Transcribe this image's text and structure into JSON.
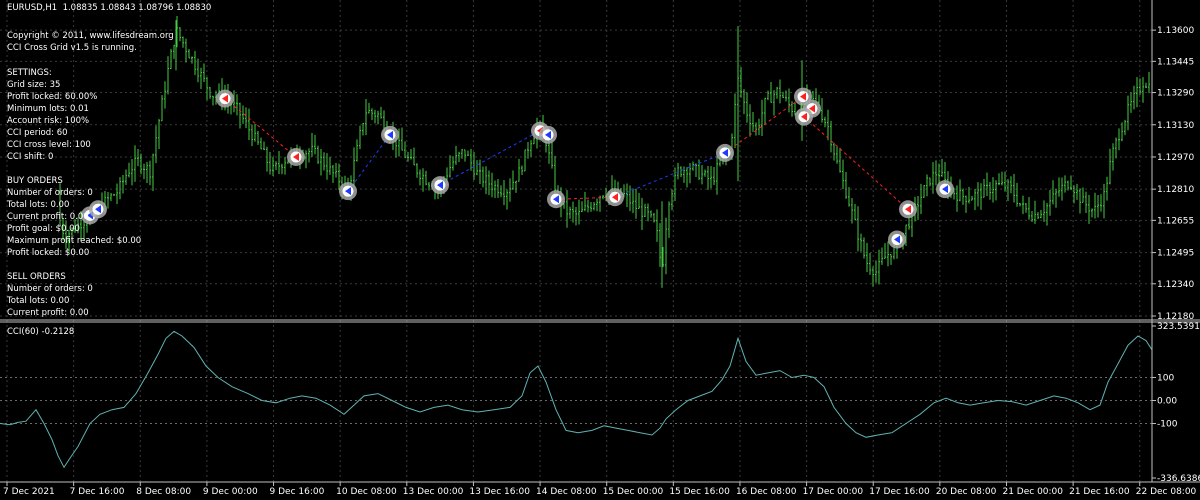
{
  "header": {
    "symbol_line": "EURUSD,H1  1.08835 1.08843 1.08796 1.08830",
    "copyright": "Copyright © 2011, www.lifesdream.org",
    "running": "CCI Cross Grid v1.5 is running."
  },
  "settings": {
    "title": "SETTINGS:",
    "lines": [
      "Grid size: 35",
      "Profit locked: 60.00%",
      "Minimum lots: 0.01",
      "Account risk: 100%",
      "CCI period: 60",
      "CCI cross level: 100",
      "CCI shift: 0"
    ]
  },
  "buy_orders": {
    "title": "BUY ORDERS",
    "lines": [
      "Number of orders: 0",
      "Total lots: 0.00",
      "Current profit: 0.00",
      "Profit goal: $0.00",
      "Maximum profit reached: $0.00",
      "Profit locked: $0.00"
    ]
  },
  "sell_orders": {
    "title": "SELL ORDERS",
    "lines": [
      "Number of orders: 0",
      "Total lots: 0.00",
      "Current profit: 0.00"
    ]
  },
  "cci_panel": {
    "label": "CCI(60) -0.2128"
  },
  "colors": {
    "background": "#000000",
    "grid": "#3a3a3a",
    "candles": "#44cc44",
    "cci_line": "#5fb3b3",
    "buy_marker": "#1e3cff",
    "sell_marker": "#ff2020",
    "marker_ring": "#a8a8a8"
  },
  "chart_data": [
    {
      "type": "bar",
      "subtype": "ohlc-candlestick",
      "instrument": "EURUSD",
      "timeframe": "H1",
      "ylim": [
        1.1218,
        1.137
      ],
      "y_ticks": [
        "1.13600",
        "1.13445",
        "1.13290",
        "1.13130",
        "1.12970",
        "1.12810",
        "1.12655",
        "1.12495",
        "1.12340",
        "1.12180"
      ],
      "y_tick_values": [
        1.136,
        1.13445,
        1.1329,
        1.1313,
        1.1297,
        1.1281,
        1.12655,
        1.12495,
        1.1234,
        1.1218
      ],
      "x_ticks": [
        "7 Dec 2021",
        "7 Dec 16:00",
        "8 Dec 08:00",
        "9 Dec 00:00",
        "9 Dec 16:00",
        "10 Dec 08:00",
        "13 Dec 00:00",
        "13 Dec 16:00",
        "14 Dec 08:00",
        "15 Dec 00:00",
        "15 Dec 16:00",
        "16 Dec 08:00",
        "17 Dec 00:00",
        "17 Dec 16:00",
        "20 Dec 08:00",
        "21 Dec 00:00",
        "21 Dec 16:00",
        "22 Dec 08:00"
      ],
      "close_path": [
        [
          0,
          1.128
        ],
        [
          12,
          1.1275
        ],
        [
          24,
          1.1272
        ],
        [
          40,
          1.1268
        ],
        [
          52,
          1.127
        ],
        [
          66,
          1.1258
        ],
        [
          82,
          1.1265
        ],
        [
          95,
          1.1268
        ],
        [
          100,
          1.1272
        ],
        [
          108,
          1.1276
        ],
        [
          118,
          1.128
        ],
        [
          128,
          1.129
        ],
        [
          138,
          1.1295
        ],
        [
          150,
          1.129
        ],
        [
          160,
          1.1318
        ],
        [
          168,
          1.134
        ],
        [
          176,
          1.136
        ],
        [
          185,
          1.1352
        ],
        [
          196,
          1.1342
        ],
        [
          206,
          1.1333
        ],
        [
          212,
          1.1328
        ],
        [
          224,
          1.1327
        ],
        [
          238,
          1.132
        ],
        [
          250,
          1.131
        ],
        [
          262,
          1.13
        ],
        [
          272,
          1.129
        ],
        [
          286,
          1.1296
        ],
        [
          298,
          1.1299
        ],
        [
          312,
          1.13
        ],
        [
          322,
          1.1295
        ],
        [
          334,
          1.1288
        ],
        [
          348,
          1.1281
        ],
        [
          356,
          1.1298
        ],
        [
          365,
          1.132
        ],
        [
          378,
          1.1318
        ],
        [
          390,
          1.1309
        ],
        [
          402,
          1.13
        ],
        [
          414,
          1.1292
        ],
        [
          428,
          1.1285
        ],
        [
          440,
          1.1282
        ],
        [
          452,
          1.1294
        ],
        [
          464,
          1.13
        ],
        [
          478,
          1.1288
        ],
        [
          492,
          1.1283
        ],
        [
          506,
          1.128
        ],
        [
          520,
          1.129
        ],
        [
          530,
          1.1305
        ],
        [
          538,
          1.1312
        ],
        [
          546,
          1.1305
        ],
        [
          556,
          1.128
        ],
        [
          566,
          1.127
        ],
        [
          578,
          1.1268
        ],
        [
          592,
          1.1274
        ],
        [
          604,
          1.128
        ],
        [
          614,
          1.1279
        ],
        [
          624,
          1.1278
        ],
        [
          636,
          1.1272
        ],
        [
          648,
          1.1268
        ],
        [
          656,
          1.1262
        ],
        [
          662,
          1.124
        ],
        [
          668,
          1.1275
        ],
        [
          678,
          1.129
        ],
        [
          690,
          1.1292
        ],
        [
          702,
          1.1288
        ],
        [
          712,
          1.1285
        ],
        [
          722,
          1.1297
        ],
        [
          730,
          1.13
        ],
        [
          738,
          1.1335
        ],
        [
          746,
          1.132
        ],
        [
          756,
          1.131
        ],
        [
          766,
          1.1325
        ],
        [
          778,
          1.133
        ],
        [
          790,
          1.1322
        ],
        [
          800,
          1.1318
        ],
        [
          808,
          1.1328
        ],
        [
          818,
          1.1322
        ],
        [
          828,
          1.1312
        ],
        [
          838,
          1.1292
        ],
        [
          846,
          1.128
        ],
        [
          856,
          1.1262
        ],
        [
          866,
          1.1245
        ],
        [
          876,
          1.124
        ],
        [
          886,
          1.1248
        ],
        [
          896,
          1.1252
        ],
        [
          906,
          1.1262
        ],
        [
          916,
          1.1272
        ],
        [
          928,
          1.1285
        ],
        [
          938,
          1.129
        ],
        [
          948,
          1.1282
        ],
        [
          958,
          1.1278
        ],
        [
          970,
          1.1277
        ],
        [
          984,
          1.128
        ],
        [
          996,
          1.1283
        ],
        [
          1010,
          1.1282
        ],
        [
          1022,
          1.1272
        ],
        [
          1034,
          1.1268
        ],
        [
          1046,
          1.1272
        ],
        [
          1058,
          1.128
        ],
        [
          1070,
          1.1285
        ],
        [
          1082,
          1.1275
        ],
        [
          1094,
          1.127
        ],
        [
          1104,
          1.1278
        ],
        [
          1112,
          1.1298
        ],
        [
          1120,
          1.131
        ],
        [
          1128,
          1.132
        ],
        [
          1136,
          1.1328
        ],
        [
          1144,
          1.1335
        ],
        [
          1150,
          1.1332
        ]
      ],
      "markers": [
        {
          "x": 90,
          "price": 1.1268,
          "side": "buy"
        },
        {
          "x": 98,
          "price": 1.1271,
          "side": "buy"
        },
        {
          "x": 225,
          "price": 1.1326,
          "side": "sell"
        },
        {
          "x": 296,
          "price": 1.1297,
          "side": "sell"
        },
        {
          "x": 348,
          "price": 1.128,
          "side": "buy"
        },
        {
          "x": 390,
          "price": 1.1308,
          "side": "buy"
        },
        {
          "x": 440,
          "price": 1.1283,
          "side": "buy"
        },
        {
          "x": 540,
          "price": 1.131,
          "side": "sell"
        },
        {
          "x": 548,
          "price": 1.1308,
          "side": "buy"
        },
        {
          "x": 556,
          "price": 1.1276,
          "side": "buy"
        },
        {
          "x": 615,
          "price": 1.1277,
          "side": "sell"
        },
        {
          "x": 725,
          "price": 1.1299,
          "side": "buy"
        },
        {
          "x": 803,
          "price": 1.1327,
          "side": "sell"
        },
        {
          "x": 812,
          "price": 1.1321,
          "side": "sell"
        },
        {
          "x": 804,
          "price": 1.1317,
          "side": "sell"
        },
        {
          "x": 897,
          "price": 1.1256,
          "side": "buy"
        },
        {
          "x": 908,
          "price": 1.1271,
          "side": "sell"
        },
        {
          "x": 945,
          "price": 1.1281,
          "side": "buy"
        }
      ],
      "trend_links": [
        {
          "from": 2,
          "to": 3,
          "color": "sell"
        },
        {
          "from": 4,
          "to": 5,
          "color": "buy"
        },
        {
          "from": 6,
          "to": 7,
          "color": "buy"
        },
        {
          "from": 9,
          "to": 10,
          "color": "sell"
        },
        {
          "from": 10,
          "to": 11,
          "color": "buy"
        },
        {
          "from": 11,
          "to": 12,
          "color": "sell"
        },
        {
          "from": 14,
          "to": 16,
          "color": "sell"
        }
      ]
    },
    {
      "type": "line",
      "series": [
        {
          "name": "CCI(60)"
        }
      ],
      "ylim": [
        -336.6386,
        323.5391
      ],
      "y_ticks": [
        "323.5391",
        "100",
        "0.00",
        "-100",
        "-336.6386"
      ],
      "y_tick_values": [
        323.5391,
        100,
        0,
        -100,
        -336.6386
      ],
      "points": [
        [
          0,
          -100
        ],
        [
          10,
          -105
        ],
        [
          18,
          -95
        ],
        [
          26,
          -90
        ],
        [
          36,
          -40
        ],
        [
          44,
          -100
        ],
        [
          52,
          -170
        ],
        [
          58,
          -240
        ],
        [
          64,
          -290
        ],
        [
          70,
          -250
        ],
        [
          78,
          -200
        ],
        [
          90,
          -100
        ],
        [
          100,
          -60
        ],
        [
          112,
          -40
        ],
        [
          124,
          -30
        ],
        [
          136,
          30
        ],
        [
          148,
          120
        ],
        [
          158,
          200
        ],
        [
          166,
          270
        ],
        [
          174,
          300
        ],
        [
          182,
          280
        ],
        [
          194,
          230
        ],
        [
          206,
          150
        ],
        [
          218,
          100
        ],
        [
          232,
          60
        ],
        [
          248,
          30
        ],
        [
          262,
          0
        ],
        [
          276,
          -10
        ],
        [
          290,
          10
        ],
        [
          302,
          20
        ],
        [
          316,
          10
        ],
        [
          330,
          -20
        ],
        [
          344,
          -60
        ],
        [
          354,
          -20
        ],
        [
          364,
          20
        ],
        [
          378,
          30
        ],
        [
          392,
          0
        ],
        [
          406,
          -30
        ],
        [
          420,
          -50
        ],
        [
          434,
          -30
        ],
        [
          448,
          -20
        ],
        [
          462,
          -40
        ],
        [
          478,
          -50
        ],
        [
          494,
          -40
        ],
        [
          510,
          -30
        ],
        [
          522,
          20
        ],
        [
          530,
          120
        ],
        [
          538,
          150
        ],
        [
          546,
          80
        ],
        [
          556,
          -40
        ],
        [
          566,
          -130
        ],
        [
          578,
          -140
        ],
        [
          592,
          -130
        ],
        [
          604,
          -110
        ],
        [
          616,
          -120
        ],
        [
          628,
          -130
        ],
        [
          640,
          -140
        ],
        [
          652,
          -150
        ],
        [
          660,
          -120
        ],
        [
          666,
          -80
        ],
        [
          676,
          -40
        ],
        [
          688,
          0
        ],
        [
          700,
          20
        ],
        [
          712,
          40
        ],
        [
          722,
          90
        ],
        [
          730,
          150
        ],
        [
          738,
          270
        ],
        [
          746,
          170
        ],
        [
          756,
          110
        ],
        [
          768,
          120
        ],
        [
          780,
          130
        ],
        [
          792,
          100
        ],
        [
          804,
          110
        ],
        [
          814,
          100
        ],
        [
          824,
          60
        ],
        [
          834,
          -30
        ],
        [
          846,
          -100
        ],
        [
          856,
          -140
        ],
        [
          866,
          -160
        ],
        [
          878,
          -150
        ],
        [
          892,
          -140
        ],
        [
          906,
          -100
        ],
        [
          920,
          -60
        ],
        [
          934,
          -10
        ],
        [
          946,
          10
        ],
        [
          958,
          -10
        ],
        [
          970,
          -20
        ],
        [
          984,
          -10
        ],
        [
          998,
          0
        ],
        [
          1012,
          -5
        ],
        [
          1026,
          -20
        ],
        [
          1040,
          0
        ],
        [
          1054,
          20
        ],
        [
          1066,
          10
        ],
        [
          1078,
          -10
        ],
        [
          1090,
          -40
        ],
        [
          1100,
          -20
        ],
        [
          1108,
          80
        ],
        [
          1118,
          160
        ],
        [
          1128,
          240
        ],
        [
          1138,
          280
        ],
        [
          1146,
          260
        ],
        [
          1152,
          220
        ]
      ]
    }
  ]
}
